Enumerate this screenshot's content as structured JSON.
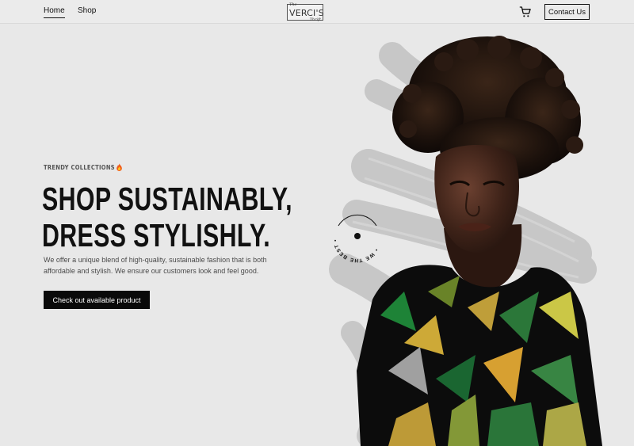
{
  "header": {
    "nav": [
      {
        "label": "Home",
        "active": true
      },
      {
        "label": "Shop",
        "active": false
      }
    ],
    "logo": {
      "top_small": "The",
      "main": "VERCI'S",
      "bottom_small": "Thrift"
    },
    "cart_icon": "shopping-cart-icon",
    "contact_label": "Contact Us"
  },
  "hero": {
    "eyebrow": "TRENDY COLLECTIONS",
    "eyebrow_icon": "fire-emoji-icon",
    "headline_line1": "SHOP SUSTAINABLY,",
    "headline_line2": "DRESS STYLISHLY.",
    "description": "We offer a unique blend of high-quality, sustainable fashion that is both affordable and stylish. We ensure our customers look and feel good.",
    "cta_label": "Check out available product",
    "badge_text": "• WE THE BEST • WE THE BEST •"
  },
  "colors": {
    "background": "#e8e8e8",
    "primary": "#0a0a0a",
    "text_muted": "#4a4a4a",
    "brush": "#c9c9c9"
  }
}
